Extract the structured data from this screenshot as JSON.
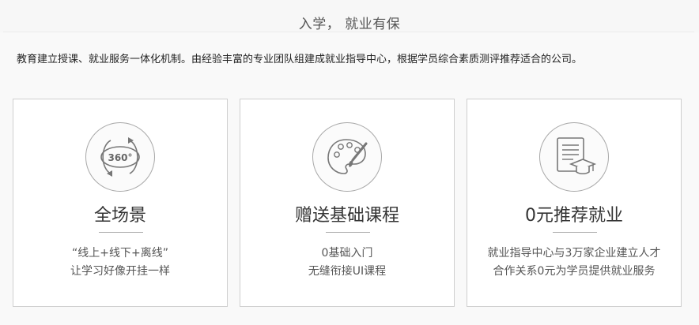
{
  "header": {
    "title": "入学， 就业有保"
  },
  "intro": {
    "text": "教育建立授课、就业服务一体化机制。由经验丰富的专业团队组建成就业指导中心，根据学员综合素质测评推荐适合的公司。"
  },
  "cards": [
    {
      "icon": "360-rotate-icon",
      "icon_text": "360°",
      "title": "全场景",
      "lines": [
        "“线上+线下+离线”",
        "让学习好像开挂一样"
      ]
    },
    {
      "icon": "palette-brush-icon",
      "title": "赠送基础课程",
      "lines": [
        "0基础入门",
        "无缝衔接UI课程"
      ]
    },
    {
      "icon": "document-graduation-cap-icon",
      "title": "0元推荐就业",
      "lines": [
        "就业指导中心与3万家企业建立人才",
        "合作关系0元为学员提供就业服务"
      ]
    }
  ],
  "colors": {
    "background": "#f7f7f7",
    "card": "#ffffff",
    "border": "#cfcfcf",
    "icon_stroke": "#777777"
  }
}
